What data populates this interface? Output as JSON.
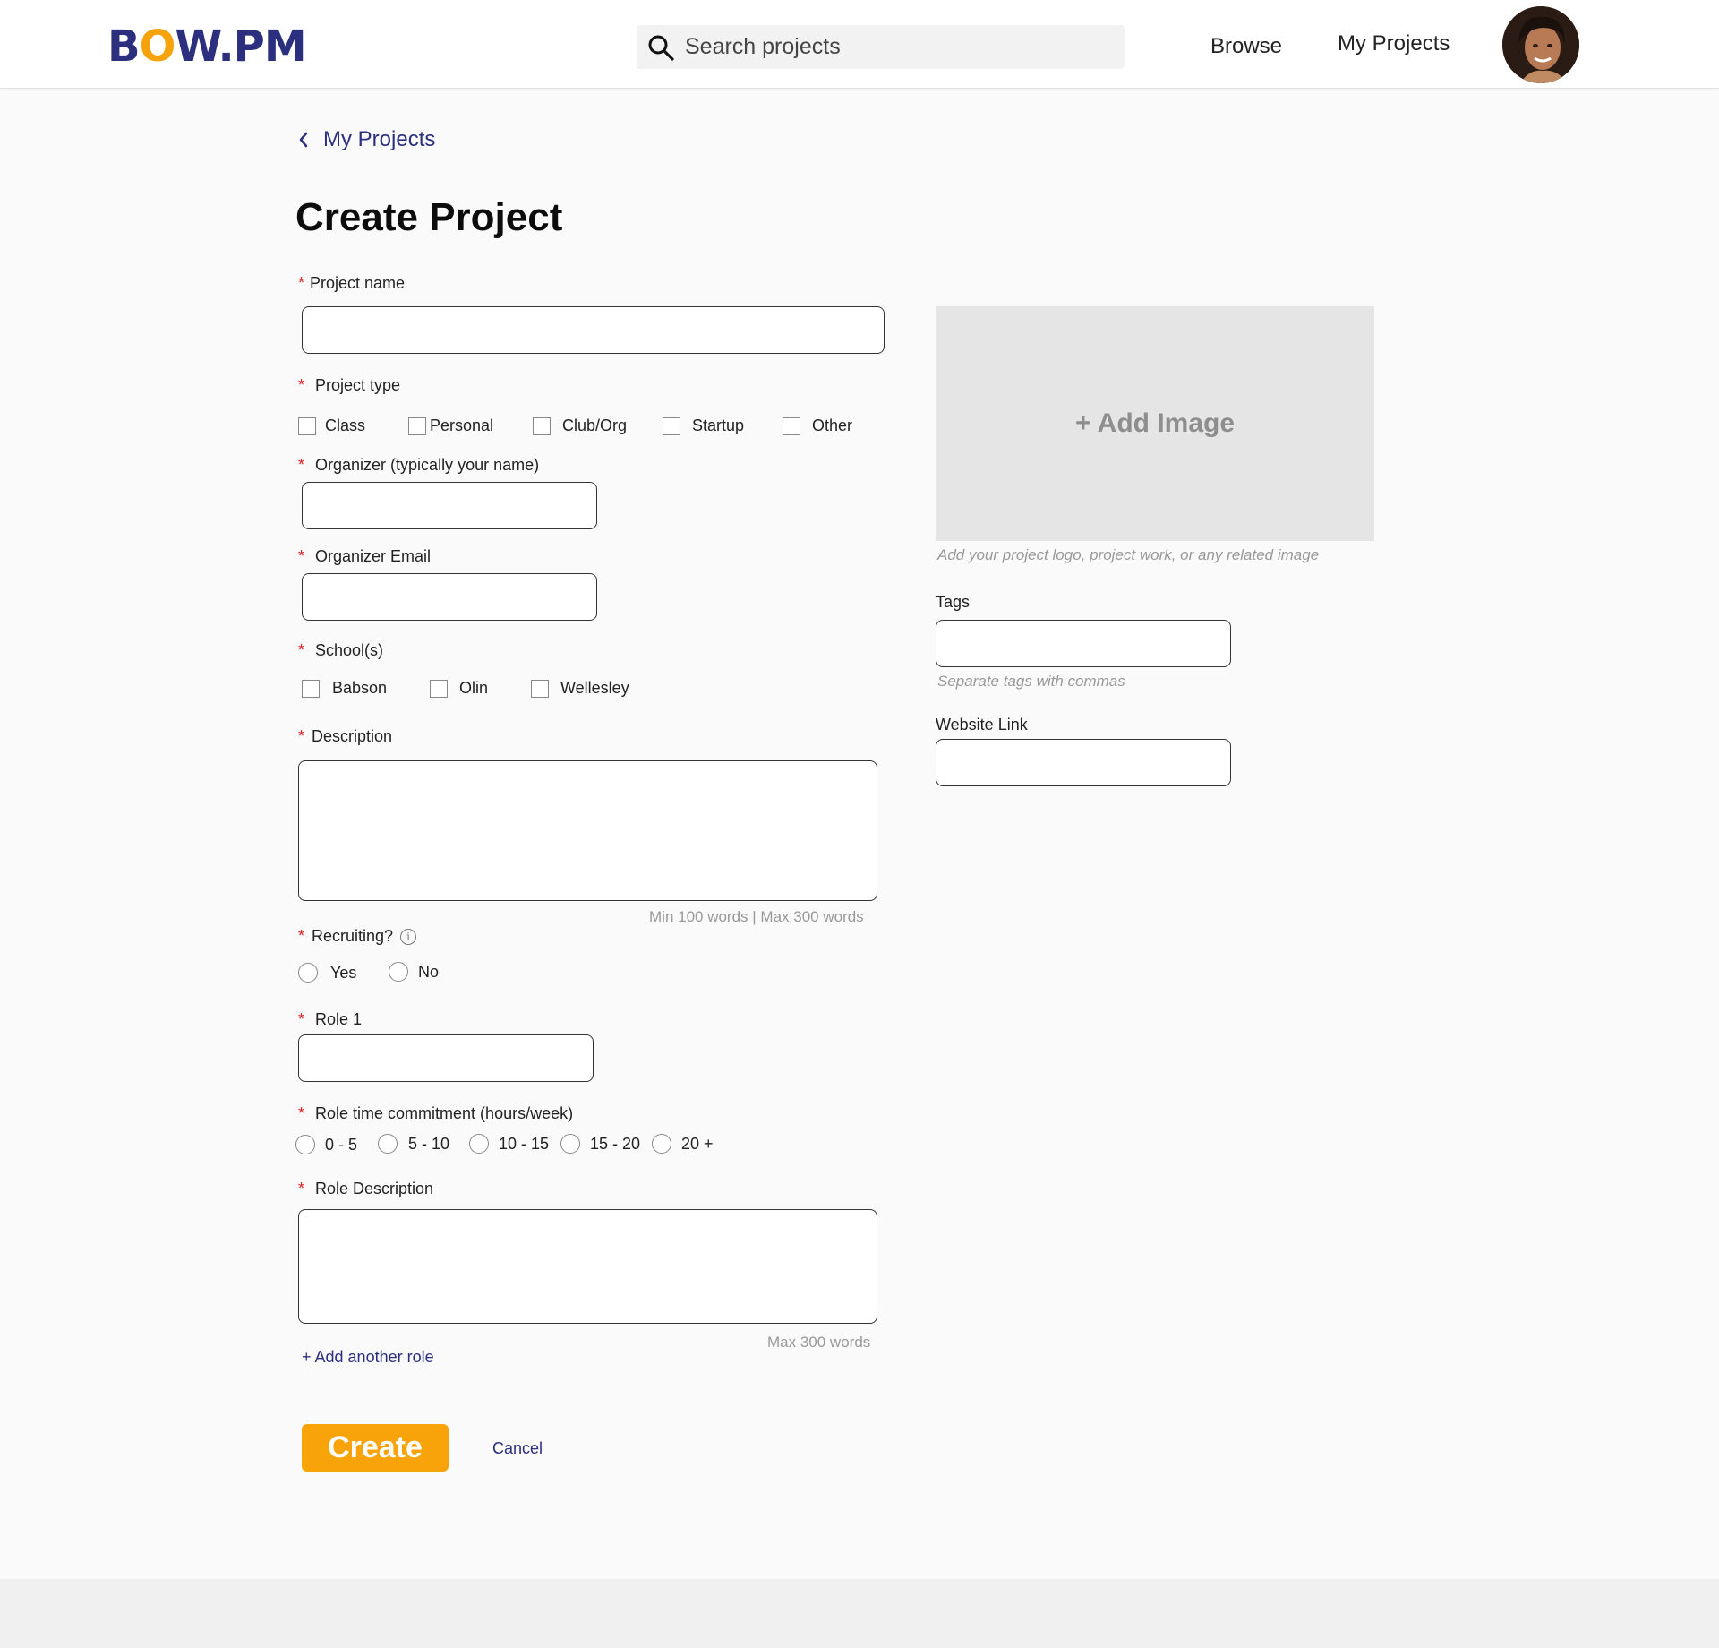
{
  "header": {
    "logo_parts": [
      "B",
      "O",
      "W.PM"
    ],
    "search_placeholder": "Search projects",
    "nav_browse": "Browse",
    "nav_my_projects": "My Projects",
    "brand_colors": {
      "navy": "#2b2f7e",
      "orange": "#f5a20b"
    }
  },
  "breadcrumb": {
    "back_label": "My Projects"
  },
  "page": {
    "title": "Create Project"
  },
  "form": {
    "required_mark": "*",
    "project_name": {
      "label": "Project name",
      "value": ""
    },
    "project_type": {
      "label": "Project type",
      "options": [
        "Class",
        "Personal",
        "Club/Org",
        "Startup",
        "Other"
      ]
    },
    "organizer": {
      "label": "Organizer (typically your name)",
      "value": ""
    },
    "organizer_email": {
      "label": "Organizer Email",
      "value": ""
    },
    "schools": {
      "label": "School(s)",
      "options": [
        "Babson",
        "Olin",
        "Wellesley"
      ]
    },
    "description": {
      "label": "Description",
      "value": "",
      "hint": "Min 100 words | Max 300 words"
    },
    "recruiting": {
      "label": "Recruiting?",
      "info_glyph": "i",
      "options": [
        "Yes",
        "No"
      ]
    },
    "role1": {
      "label": "Role 1",
      "value": ""
    },
    "time_commitment": {
      "label": "Role time commitment (hours/week)",
      "options": [
        "0 - 5",
        "5 - 10",
        "10 - 15",
        "15 - 20",
        "20 +"
      ]
    },
    "role_description": {
      "label": "Role Description",
      "value": "",
      "hint": "Max 300 words"
    },
    "add_role": "+ Add another role",
    "image": {
      "button": "+ Add Image",
      "hint": "Add your project logo, project work, or any related image"
    },
    "tags": {
      "label": "Tags",
      "value": "",
      "hint": "Separate tags with commas"
    },
    "website": {
      "label": "Website Link",
      "value": ""
    },
    "create_button": "Create",
    "cancel_link": "Cancel"
  }
}
